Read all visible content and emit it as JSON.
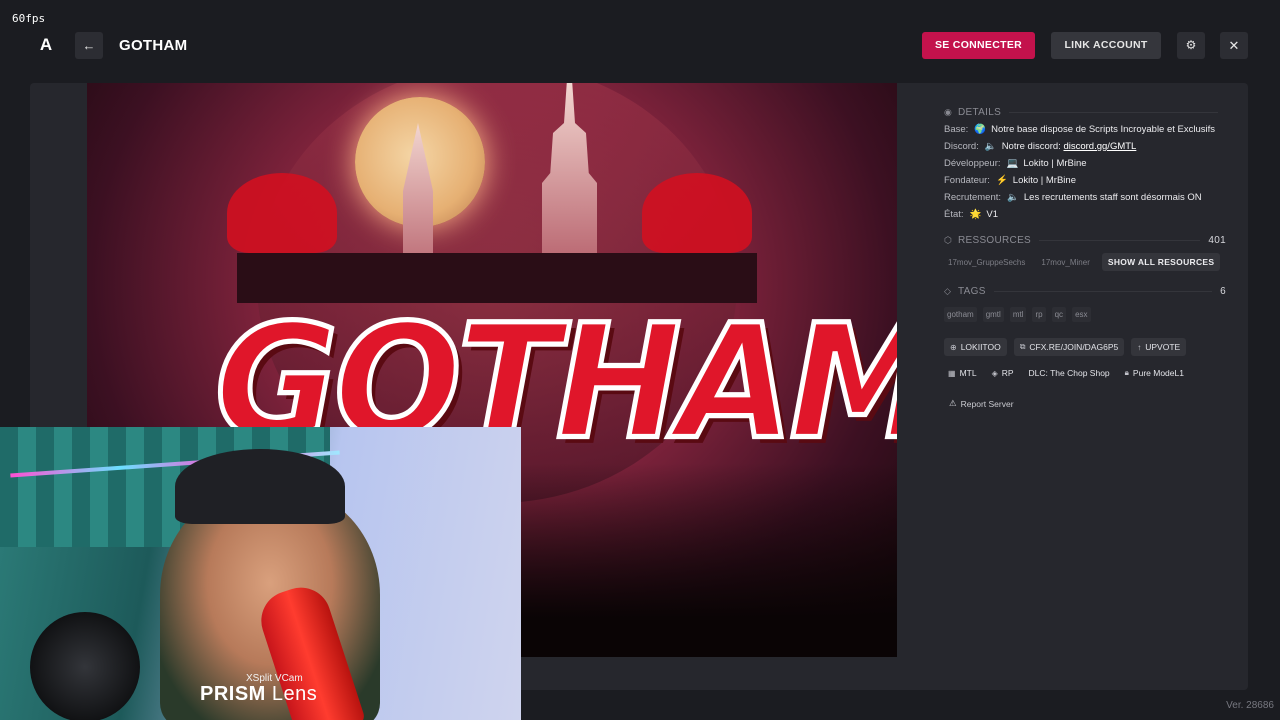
{
  "overlay": {
    "fps": "60fps"
  },
  "header": {
    "logo_icon": "A",
    "back_icon": "←",
    "title": "GOTHAM",
    "connect_label": "SE CONNECTER",
    "link_label": "LINK ACCOUNT",
    "settings_icon": "⚙",
    "close_icon": "✕"
  },
  "banner": {
    "logo_text": "GOTHAM"
  },
  "webcam": {
    "brand_sub": "XSplit VCam",
    "brand_main": "PRISM",
    "brand_main2": " Lens"
  },
  "details": {
    "heading": "DETAILS",
    "rows": [
      {
        "key": "Base:",
        "emoji": "🌍",
        "value": "Notre base dispose de Scripts Incroyable et Exclusifs"
      },
      {
        "key": "Discord:",
        "emoji": "🔈",
        "value": "Notre discord: ",
        "link": "discord.gg/GMTL"
      },
      {
        "key": "Développeur:",
        "emoji": "💻",
        "value": "Lokito | MrBine"
      },
      {
        "key": "Fondateur:",
        "emoji": "⚡",
        "value": "Lokito | MrBine"
      },
      {
        "key": "Recrutement:",
        "emoji": "🔈",
        "value": "Les recrutements staff sont désormais ON"
      },
      {
        "key": "État:",
        "emoji": "🌟",
        "value": "V1"
      }
    ]
  },
  "resources": {
    "heading": "RESSOURCES",
    "count": "401",
    "items": [
      "17mov_GruppeSechs",
      "17mov_Miner"
    ],
    "show_all_label": "SHOW ALL RESOURCES"
  },
  "tags": {
    "heading": "TAGS",
    "count": "6",
    "items": [
      "gotham",
      "gmtl",
      "mtl",
      "rp",
      "qc",
      "esx"
    ]
  },
  "actions": {
    "owner": "LOKIITOO",
    "connect_url": "CFX.RE/JOIN/DAG6P5",
    "upvote": "UPVOTE"
  },
  "meta": {
    "locale": "MTL",
    "gametype": "RP",
    "dlc": "DLC: The Chop Shop",
    "pure_mode": "Pure Mode",
    "pure_level": "L1"
  },
  "report_label": "Report Server",
  "footer": {
    "version": "Ver. 28686"
  }
}
